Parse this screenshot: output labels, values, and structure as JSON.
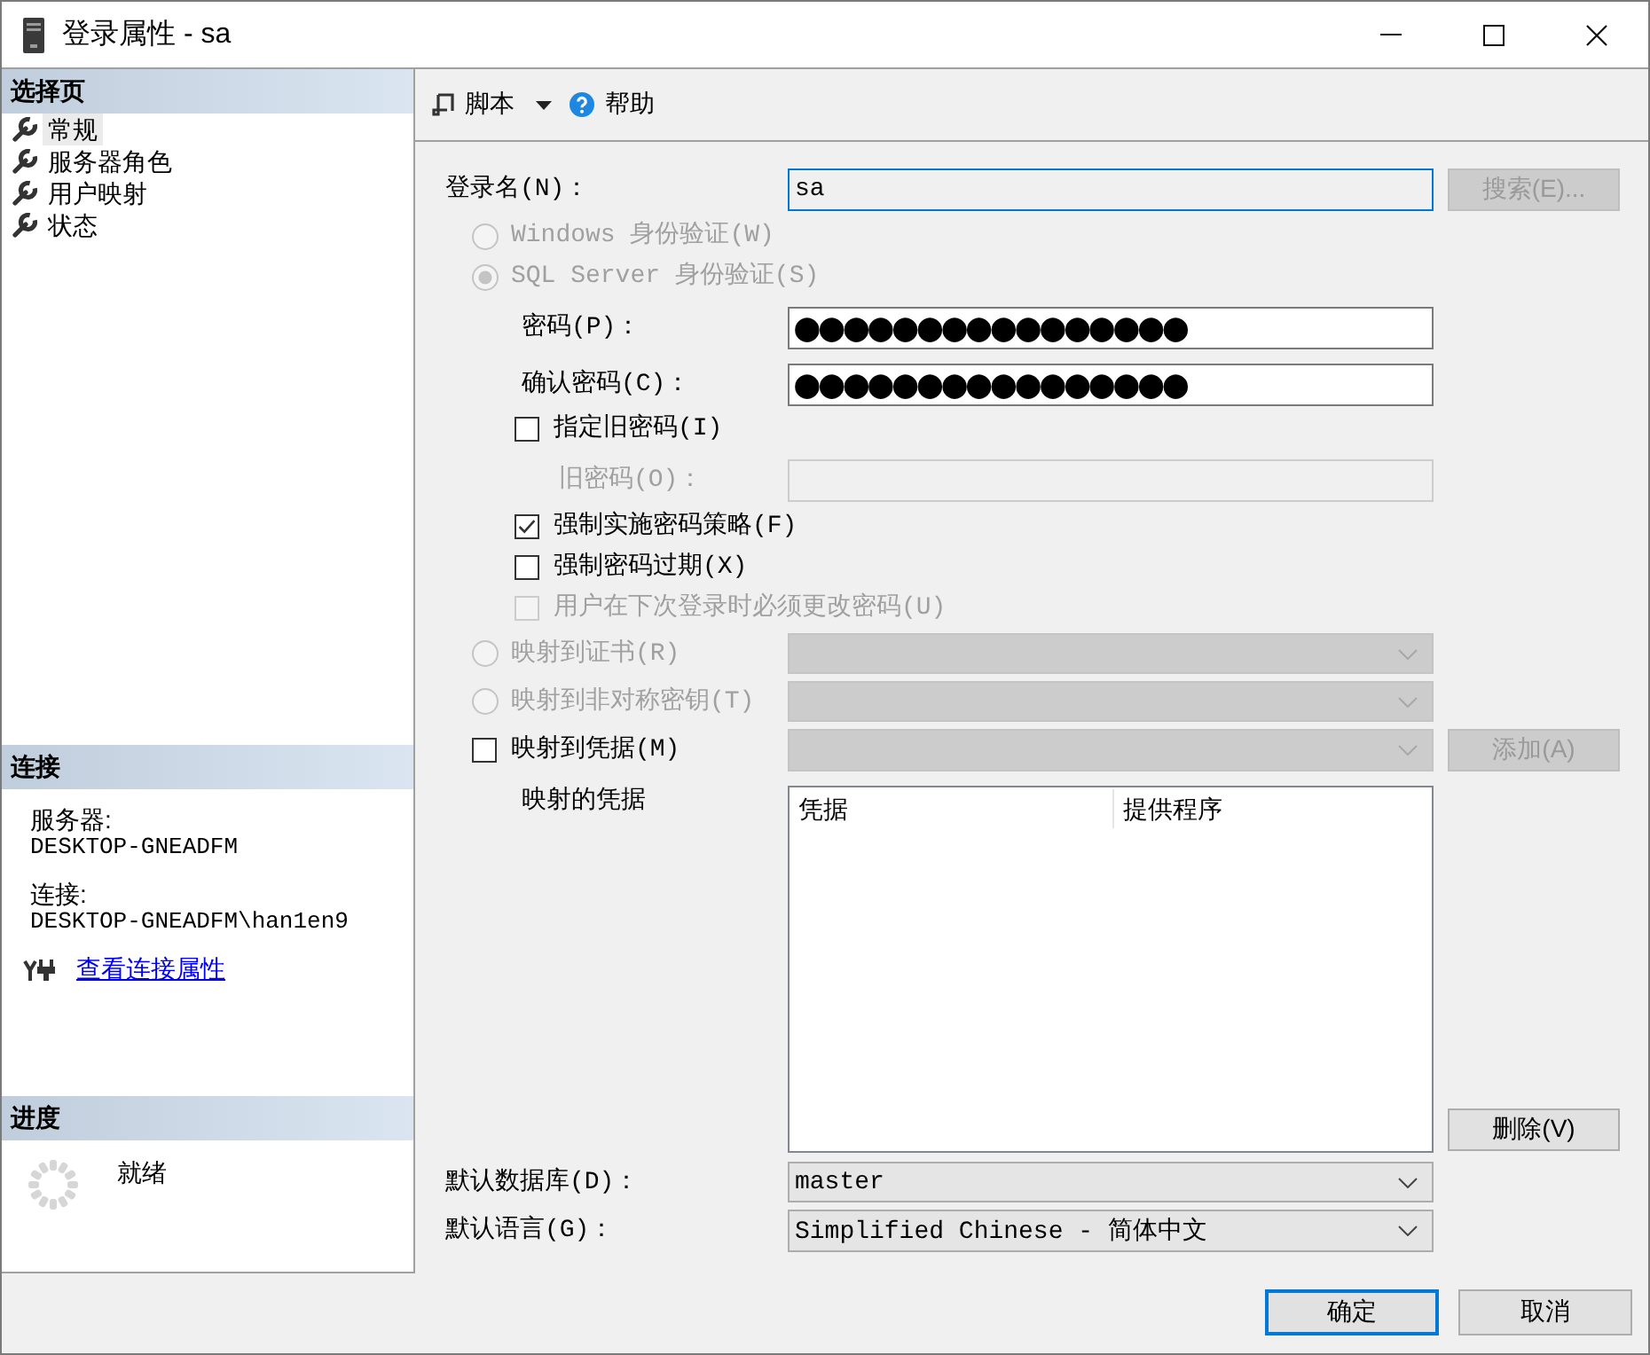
{
  "window": {
    "title": "登录属性 - sa"
  },
  "sidebar": {
    "pages_header": "选择页",
    "pages": [
      {
        "label": "常规",
        "selected": true
      },
      {
        "label": "服务器角色",
        "selected": false
      },
      {
        "label": "用户映射",
        "selected": false
      },
      {
        "label": "状态",
        "selected": false
      }
    ],
    "connection_header": "连接",
    "connection": [
      {
        "label": "服务器:",
        "value": "DESKTOP-GNEADFM"
      },
      {
        "label": "连接:",
        "value": "DESKTOP-GNEADFM\\han1en9"
      }
    ],
    "connection_link": "查看连接属性",
    "progress_header": "进度",
    "progress_status": "就绪"
  },
  "toolbar": [
    {
      "kind": "script",
      "label": "脚本",
      "menu": true
    },
    {
      "kind": "help",
      "label": "帮助",
      "menu": false
    }
  ],
  "form": {
    "login_name": {
      "label": "登录名(N)：",
      "value": "sa",
      "focused": true,
      "button": {
        "label": "搜索(E)...",
        "disabled": true
      }
    },
    "auth_options": [
      {
        "label": "Windows 身份验证(W)",
        "selected": false,
        "disabled": true
      },
      {
        "label": "SQL Server 身份验证(S)",
        "selected": true,
        "disabled": true
      }
    ],
    "password": {
      "label": "密码(P)：",
      "value": "●●●●●●●●●●●●●●●●"
    },
    "confirm_password": {
      "label": "确认密码(C)：",
      "value": "●●●●●●●●●●●●●●●●"
    },
    "specify_old_password": {
      "label": "指定旧密码(I)",
      "checked": false,
      "disabled": false
    },
    "old_password": {
      "label": "旧密码(O)：",
      "disabled": true
    },
    "policy_options": [
      {
        "label": "强制实施密码策略(F)",
        "checked": true,
        "disabled": false
      },
      {
        "label": "强制密码过期(X)",
        "checked": false,
        "disabled": false
      },
      {
        "label": "用户在下次登录时必须更改密码(U)",
        "checked": false,
        "disabled": true
      }
    ],
    "mapping_options": [
      {
        "kind": "radio",
        "label": "映射到证书(R)",
        "selected": false,
        "disabled": true,
        "dropdown_disabled": true
      },
      {
        "kind": "radio",
        "label": "映射到非对称密钥(T)",
        "selected": false,
        "disabled": true,
        "dropdown_disabled": true
      },
      {
        "kind": "checkbox",
        "label": "映射到凭据(M)",
        "checked": false,
        "disabled": false,
        "dropdown_disabled": true,
        "button": {
          "label": "添加(A)",
          "disabled": true
        }
      }
    ],
    "mapped_credentials": {
      "label": "映射的凭据",
      "columns": [
        "凭据",
        "提供程序"
      ],
      "button": {
        "label": "删除(V)",
        "disabled": false
      }
    },
    "default_database": {
      "label": "默认数据库(D)：",
      "value": "master"
    },
    "default_language": {
      "label": "默认语言(G)：",
      "value": "Simplified Chinese - 简体中文"
    }
  },
  "buttons": [
    {
      "label": "确定",
      "default": true
    },
    {
      "label": "取消",
      "default": false
    }
  ]
}
